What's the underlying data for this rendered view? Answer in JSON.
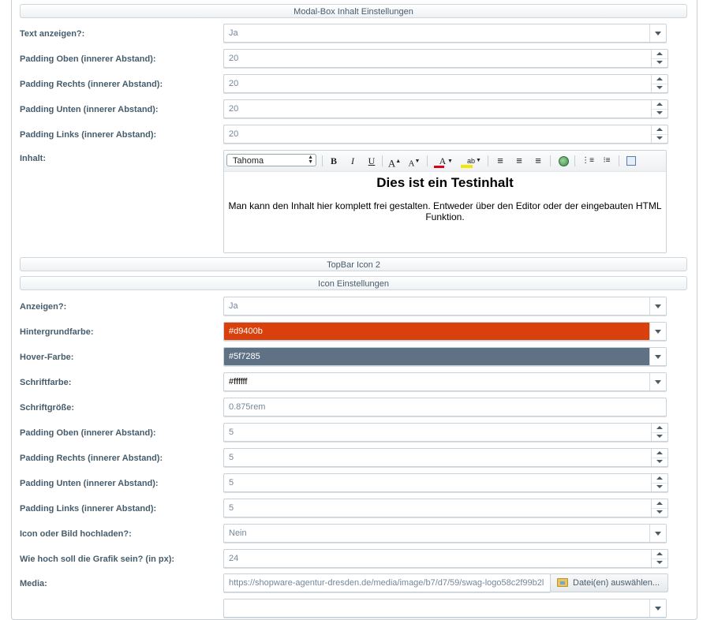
{
  "modal_section": {
    "title": "Modal-Box Inhalt Einstellungen",
    "fields": [
      {
        "label": "Text anzeigen?:",
        "value": "Ja",
        "type": "select"
      },
      {
        "label": "Padding Oben (innerer Abstand):",
        "value": "20",
        "type": "number"
      },
      {
        "label": "Padding Rechts (innerer Abstand):",
        "value": "20",
        "type": "number"
      },
      {
        "label": "Padding Unten (innerer Abstand):",
        "value": "20",
        "type": "number"
      },
      {
        "label": "Padding Links (innerer Abstand):",
        "value": "20",
        "type": "number"
      }
    ],
    "content_label": "Inhalt:",
    "editor": {
      "font": "Tahoma",
      "heading": "Dies ist ein Testinhalt",
      "body": "Man kann den Inhalt hier komplett frei gestalten. Entweder über den Editor oder der eingebauten HTML Funktion."
    }
  },
  "topbar_section": {
    "title": "TopBar Icon 2"
  },
  "icon_section": {
    "title": "Icon Einstellungen",
    "fields": [
      {
        "label": "Anzeigen?:",
        "value": "Ja",
        "type": "select"
      },
      {
        "label": "Hintergrundfarbe:",
        "value": "#d9400b",
        "type": "color",
        "color": "#d9400b"
      },
      {
        "label": "Hover-Farbe:",
        "value": "#5f7285",
        "type": "color",
        "color": "#5f7285"
      },
      {
        "label": "Schriftfarbe:",
        "value": "#ffffff",
        "type": "color",
        "color": "#ffffff"
      },
      {
        "label": "Schriftgröße:",
        "value": "0.875rem",
        "type": "text"
      },
      {
        "label": "Padding Oben (innerer Abstand):",
        "value": "5",
        "type": "number"
      },
      {
        "label": "Padding Rechts (innerer Abstand):",
        "value": "5",
        "type": "number"
      },
      {
        "label": "Padding Unten (innerer Abstand):",
        "value": "5",
        "type": "number"
      },
      {
        "label": "Padding Links (innerer Abstand):",
        "value": "5",
        "type": "number"
      },
      {
        "label": "Icon oder Bild hochladen?:",
        "value": "Nein",
        "type": "select"
      },
      {
        "label": "Wie hoch soll die Grafik sein? (in px):",
        "value": "24",
        "type": "number"
      }
    ],
    "media": {
      "label": "Media:",
      "value": "https://shopware-agentur-dresden.de/media/image/b7/d7/59/swag-logo58c2f99b2l",
      "button_label": "Datei(en) auswählen..."
    }
  }
}
